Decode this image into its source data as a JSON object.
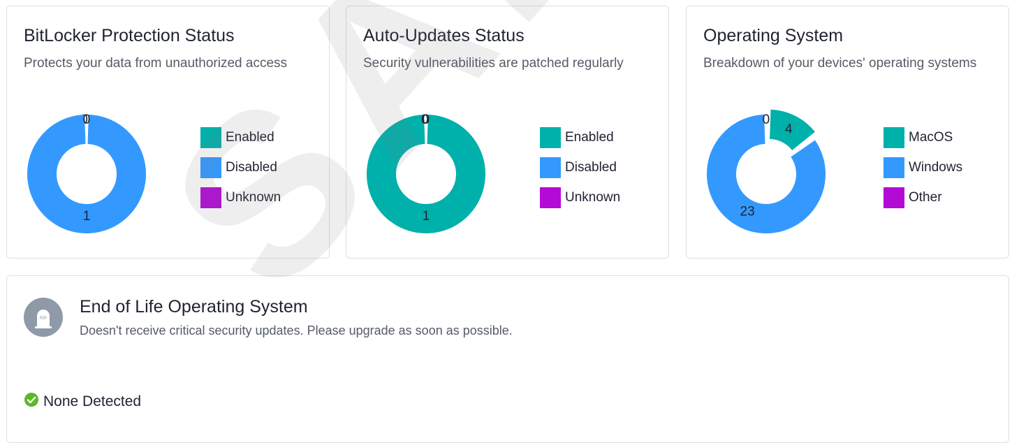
{
  "colors": {
    "enabled": "#00b0aa",
    "disabled": "#3399ff",
    "unknown": "#b40ad6",
    "success": "#5cb82a"
  },
  "cards": [
    {
      "title": "BitLocker Protection Status",
      "description": "Protects your data from unauthorized access",
      "chart_data": {
        "type": "donut",
        "categories": [
          "Enabled",
          "Disabled",
          "Unknown"
        ],
        "values": [
          0,
          1,
          0
        ],
        "data_labels": [
          "0",
          "1",
          "0"
        ]
      },
      "legend": [
        {
          "label": "Enabled",
          "color": "#00b0aa"
        },
        {
          "label": "Disabled",
          "color": "#3399ff"
        },
        {
          "label": "Unknown",
          "color": "#b40ad6"
        }
      ]
    },
    {
      "title": "Auto-Updates Status",
      "description": "Security vulnerabilities are patched regularly",
      "chart_data": {
        "type": "donut",
        "categories": [
          "Enabled",
          "Disabled",
          "Unknown"
        ],
        "values": [
          1,
          0,
          0
        ],
        "data_labels": [
          "1",
          "0",
          "0"
        ]
      },
      "legend": [
        {
          "label": "Enabled",
          "color": "#00b0aa"
        },
        {
          "label": "Disabled",
          "color": "#3399ff"
        },
        {
          "label": "Unknown",
          "color": "#b40ad6"
        }
      ]
    },
    {
      "title": "Operating System",
      "description": "Breakdown of your devices' operating systems",
      "chart_data": {
        "type": "donut",
        "categories": [
          "MacOS",
          "Windows",
          "Other"
        ],
        "values": [
          4,
          23,
          0
        ],
        "data_labels": [
          "4",
          "23",
          "0"
        ]
      },
      "legend": [
        {
          "label": "MacOS",
          "color": "#00b0aa"
        },
        {
          "label": "Windows",
          "color": "#3399ff"
        },
        {
          "label": "Other",
          "color": "#b40ad6"
        }
      ]
    }
  ],
  "eol": {
    "icon": "tombstone-icon",
    "icon_text": "RIP",
    "title": "End of Life Operating System",
    "description": "Doesn't receive critical security updates. Please upgrade as soon as possible.",
    "status_icon": "check-circle-icon",
    "status": "None Detected"
  },
  "watermark": "SAMPLE"
}
